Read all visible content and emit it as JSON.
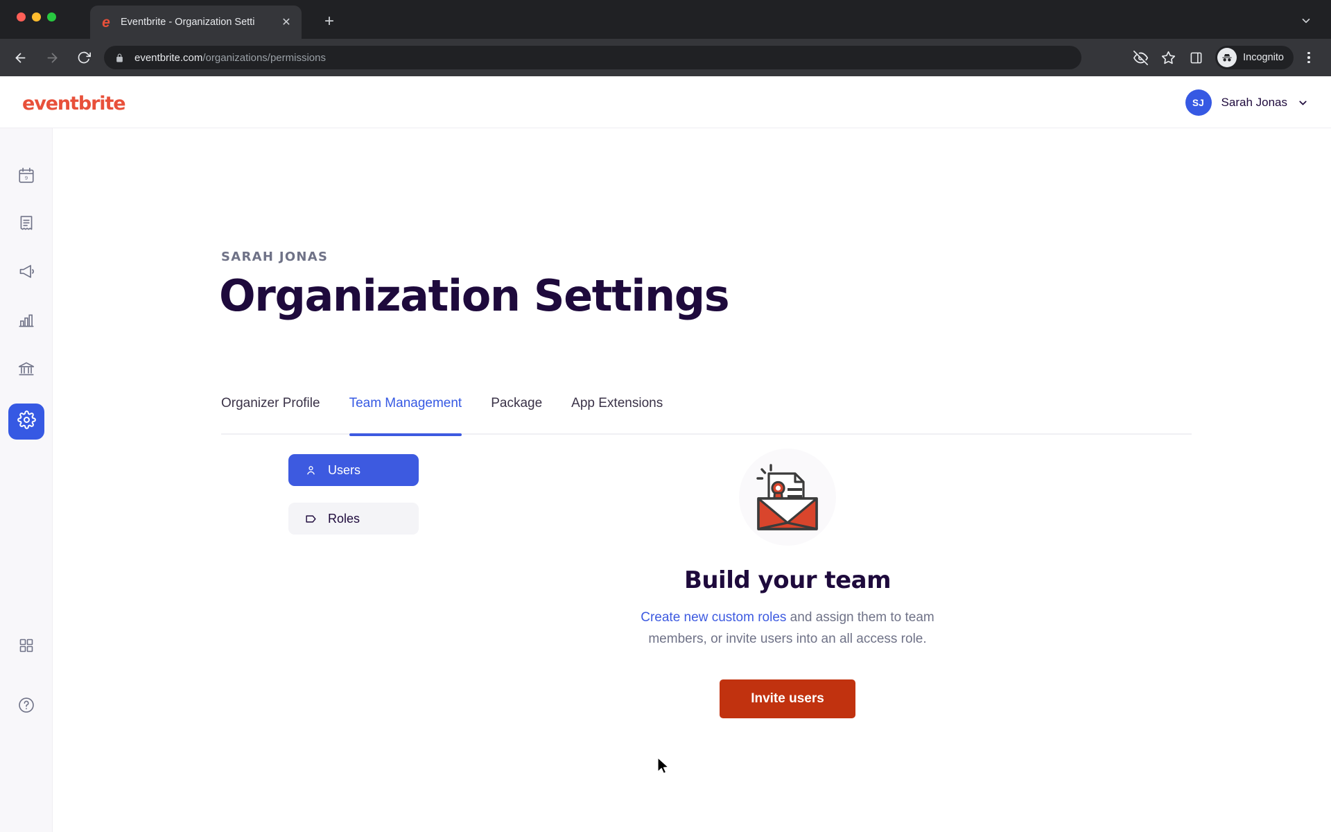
{
  "browser": {
    "tab": {
      "title": "Eventbrite - Organization Setti",
      "favicon": "eventbrite-e-icon",
      "close_label": "✕"
    },
    "new_tab_label": "+",
    "url_domain": "eventbrite.com",
    "url_path": "/organizations/permissions",
    "profile_label": "Incognito",
    "icons": [
      "back-arrow",
      "forward-arrow",
      "reload",
      "lock",
      "hidden-eye",
      "star",
      "side-panel",
      "incognito",
      "kebab-menu",
      "tabstrip-chevron"
    ]
  },
  "app_header": {
    "logo_text": "eventbrite",
    "logo_color": "#e8503a",
    "account": {
      "initials": "SJ",
      "name": "Sarah Jonas",
      "avatar_color": "#3659e3"
    }
  },
  "rail": {
    "items": [
      {
        "name": "calendar",
        "label": "Events",
        "badge": "9",
        "active": false
      },
      {
        "name": "receipt",
        "label": "Orders",
        "active": false
      },
      {
        "name": "megaphone",
        "label": "Marketing",
        "active": false
      },
      {
        "name": "bar-chart",
        "label": "Reports",
        "active": false
      },
      {
        "name": "bank",
        "label": "Finance",
        "active": false
      },
      {
        "name": "gear",
        "label": "Settings",
        "active": true
      }
    ],
    "bottom_items": [
      {
        "name": "apps-grid",
        "label": "Apps"
      },
      {
        "name": "help-circle",
        "label": "Help"
      }
    ]
  },
  "main": {
    "eyebrow": "SARAH JONAS",
    "title": "Organization Settings",
    "tabs": [
      {
        "label": "Organizer Profile",
        "active": false
      },
      {
        "label": "Team Management",
        "active": true
      },
      {
        "label": "Package",
        "active": false
      },
      {
        "label": "App Extensions",
        "active": false
      }
    ],
    "subnav": [
      {
        "label": "Users",
        "icon": "person-icon",
        "active": true
      },
      {
        "label": "Roles",
        "icon": "tag-icon",
        "active": false
      }
    ],
    "empty_state": {
      "illustration": "envelope-with-certificate-icon",
      "title": "Build your team",
      "desc_link": "Create new custom roles",
      "desc_rest": " and assign them to team members, or invite users into an all access role.",
      "button_label": "Invite users",
      "button_color": "#c1320f"
    }
  },
  "colors": {
    "brand_red": "#e8503a",
    "accent_blue": "#3d5ae0",
    "title_purple": "#1e0a3c",
    "muted_gray": "#6f7287"
  }
}
